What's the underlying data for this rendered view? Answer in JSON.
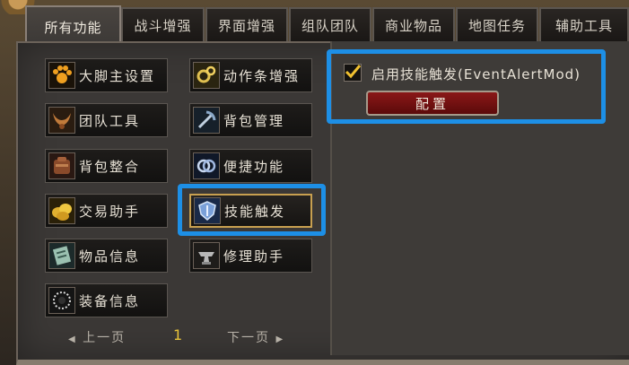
{
  "tabs": [
    {
      "label": "所有功能",
      "active": true
    },
    {
      "label": "战斗增强"
    },
    {
      "label": "界面增强"
    },
    {
      "label": "组队团队"
    },
    {
      "label": "商业物品"
    },
    {
      "label": "地图任务"
    },
    {
      "label": "辅助工具"
    }
  ],
  "features": {
    "left": [
      {
        "label": "大脚主设置",
        "icon": "paw-icon"
      },
      {
        "label": "团队工具",
        "icon": "horns-icon"
      },
      {
        "label": "背包整合",
        "icon": "bag-icon"
      },
      {
        "label": "交易助手",
        "icon": "coins-icon"
      },
      {
        "label": "物品信息",
        "icon": "scroll-icon"
      },
      {
        "label": "装备信息",
        "icon": "necklace-icon"
      }
    ],
    "right": [
      {
        "label": "动作条增强",
        "icon": "gear-icon"
      },
      {
        "label": "背包管理",
        "icon": "pickaxe-icon"
      },
      {
        "label": "便捷功能",
        "icon": "rings-icon"
      },
      {
        "label": "技能触发",
        "icon": "shield-icon",
        "selected": true
      },
      {
        "label": "修理助手",
        "icon": "anvil-icon"
      }
    ]
  },
  "pager": {
    "prev": "上一页",
    "next": "下一页",
    "current": "1"
  },
  "settings": {
    "enable_label": "启用技能触发(EventAlertMod)",
    "enabled": true,
    "config_label": "配置"
  },
  "colors": {
    "highlight": "#1d8fe6",
    "selected_border": "#c8a050",
    "config_button": "#7a1212",
    "page_number": "#e8c33a"
  }
}
